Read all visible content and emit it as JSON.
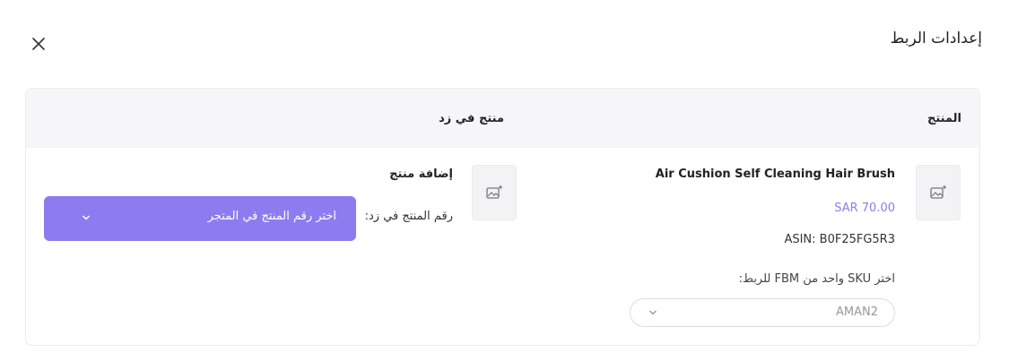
{
  "dialog": {
    "title": "إعدادات الربط",
    "close_icon": "close-icon"
  },
  "table": {
    "headers": {
      "product": "المنتج",
      "zid_product": "منتج في زد"
    }
  },
  "product": {
    "image_icon": "image-placeholder-icon",
    "name": "Air Cushion Self Cleaning Hair Brush",
    "price": "SAR 70.00",
    "asin": "ASIN: B0F25FG5R3",
    "sku_label": "اختر SKU واحد من FBM للربط:",
    "sku_value": "AMAN2"
  },
  "zid": {
    "image_icon": "image-placeholder-icon",
    "add_title": "إضافة منتج",
    "number_label": "رقم المنتج في زد:",
    "select_placeholder": "اختر رقم المنتج في المتجر"
  },
  "colors": {
    "accent": "#8c7cf0",
    "header_bg": "#f6f6f8",
    "border": "#ececf0"
  }
}
